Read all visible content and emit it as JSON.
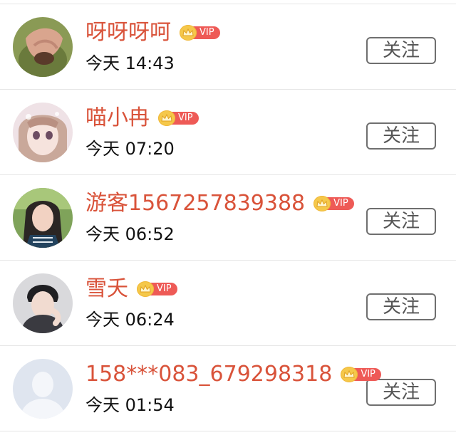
{
  "users": [
    {
      "name": "呀呀呀呵",
      "vip": "VIP",
      "time": "今天 14:43",
      "follow": "关注"
    },
    {
      "name": "喵小冉",
      "vip": "VIP",
      "time": "今天 07:20",
      "follow": "关注"
    },
    {
      "name": "游客1567257839388",
      "vip": "VIP",
      "time": "今天 06:52",
      "follow": "关注"
    },
    {
      "name": "雪夭",
      "vip": "VIP",
      "time": "今天 06:24",
      "follow": "关注"
    },
    {
      "name": "158***083_679298318",
      "vip": "VIP",
      "time": "今天 01:54",
      "follow": "关注"
    }
  ],
  "icons": {
    "vip_crown": "crown-icon",
    "avatar_default": "default-avatar-icon"
  },
  "colors": {
    "name": "#d9533a",
    "vip_tag": "#ee5a56",
    "crown": "#f5c84a",
    "divider": "#e6e6e6"
  }
}
